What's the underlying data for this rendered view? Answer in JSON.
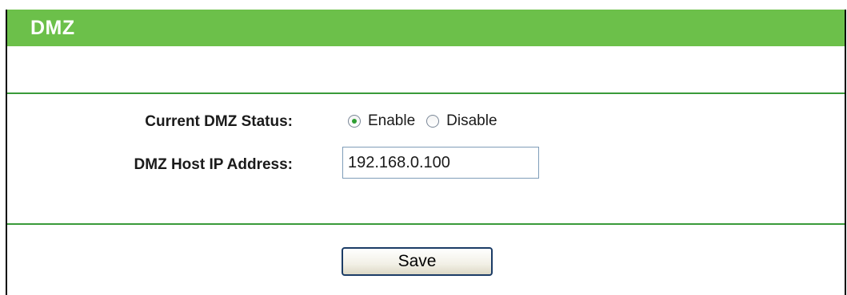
{
  "page": {
    "title": "DMZ"
  },
  "form": {
    "status_label": "Current DMZ Status:",
    "status_options": [
      {
        "label": "Enable",
        "checked": true
      },
      {
        "label": "Disable",
        "checked": false
      }
    ],
    "ip_label": "DMZ Host IP Address:",
    "ip_value": "192.168.0.100"
  },
  "actions": {
    "save_label": "Save"
  },
  "colors": {
    "title_bar": "#6cc04a",
    "divider": "#3a9a3a",
    "radio_selected": "#2f9e33"
  }
}
